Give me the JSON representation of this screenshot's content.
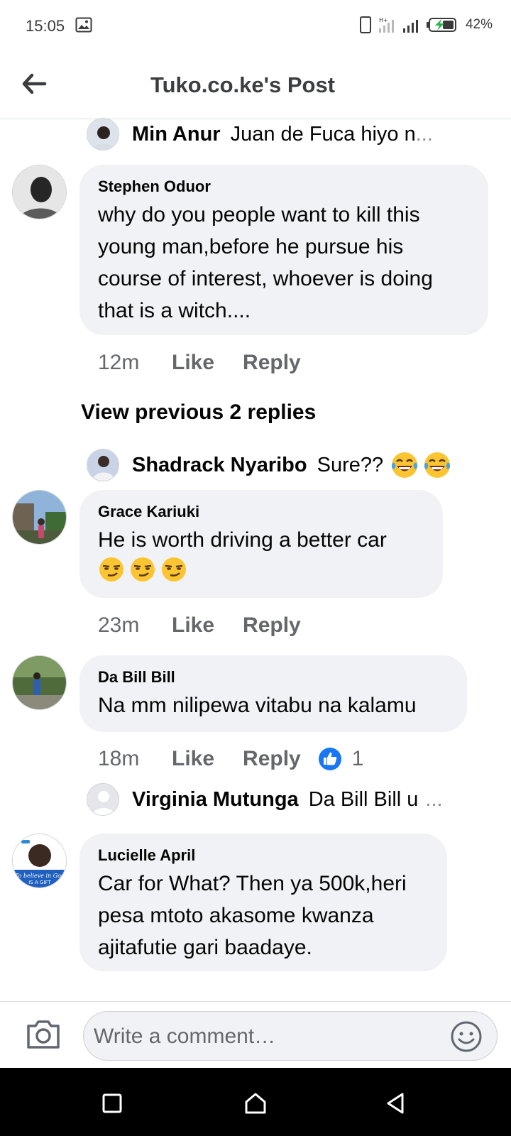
{
  "status_bar": {
    "time": "15:05",
    "battery": "42%"
  },
  "header": {
    "title": "Tuko.co.ke's Post",
    "back_icon": "arrow-left-icon"
  },
  "thread": {
    "top_reply": {
      "name": "Min Anur",
      "text": "Juan de Fuca  hiyo n",
      "ellipsis": "..."
    },
    "comments": [
      {
        "name": "Stephen Oduor",
        "lines": [
          "why do you people want to kill this",
          "young man,before he pursue his",
          "course of interest, whoever is doing",
          "that is a witch...."
        ],
        "time": "12m",
        "like": "Like",
        "reply": "Reply"
      },
      {
        "name": "Grace Kariuki",
        "lines": [
          "He is worth driving a better car"
        ],
        "emoji": "smirking-face-emoji",
        "time": "23m",
        "like": "Like",
        "reply": "Reply"
      },
      {
        "name": "Da Bill Bill",
        "lines": [
          "Na mm nilipewa vitabu na kalamu"
        ],
        "time": "18m",
        "like": "Like",
        "reply": "Reply",
        "reaction_count": "1"
      },
      {
        "name": "Lucielle April",
        "lines": [
          "Car for What? Then ya 500k,heri",
          "pesa mtoto akasome kwanza",
          "ajitafutie gari baadaye."
        ]
      }
    ],
    "view_previous": "View previous 2 replies",
    "shadrack_reply": {
      "name": "Shadrack Nyaribo",
      "text": "Sure??"
    },
    "virginia_reply": {
      "name": "Virginia Mutunga",
      "text": "Da Bill Bill u",
      "ellipsis": "..."
    },
    "avatar_badge": {
      "line1": "To believe in God",
      "line2": "IS A GIFT"
    }
  },
  "composer": {
    "placeholder": "Write a comment…"
  },
  "colors": {
    "bubble": "#f0f2f5",
    "like_blue": "#1877f2",
    "secondary_text": "#65676b"
  }
}
